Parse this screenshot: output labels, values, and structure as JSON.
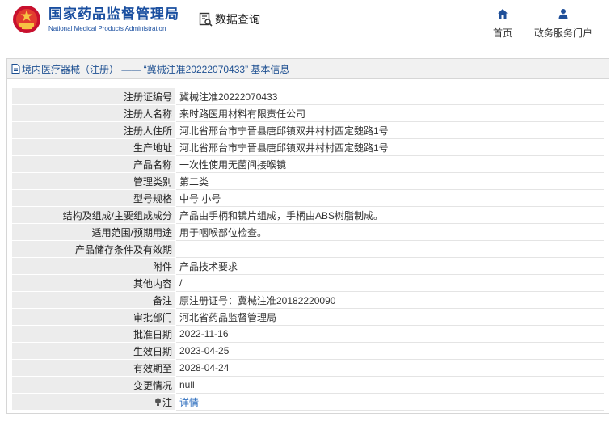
{
  "header": {
    "brand_cn": "国家药品监督管理局",
    "brand_en": "National Medical Products Administration",
    "query_label": "数据查询",
    "nav": [
      {
        "label": "首页",
        "icon": "home-icon"
      },
      {
        "label": "政务服务门户",
        "icon": "user-icon"
      }
    ],
    "brand_color": "#1a4fa0",
    "logo_color": "#c8102e"
  },
  "panel": {
    "title": "境内医疗器械（注册） —— “冀械注准20222070433” 基本信息"
  },
  "rows": [
    {
      "label": "注册证编号",
      "value": "冀械注准20222070433"
    },
    {
      "label": "注册人名称",
      "value": "来时路医用材料有限责任公司"
    },
    {
      "label": "注册人住所",
      "value": "河北省邢台市宁晋县唐邱镇双井村村西定魏路1号"
    },
    {
      "label": "生产地址",
      "value": "河北省邢台市宁晋县唐邱镇双井村村西定魏路1号"
    },
    {
      "label": "产品名称",
      "value": "一次性使用无菌间接喉镜"
    },
    {
      "label": "管理类别",
      "value": "第二类"
    },
    {
      "label": "型号规格",
      "value": "中号 小号"
    },
    {
      "label": "结构及组成/主要组成成分",
      "value": "产品由手柄和镜片组成，手柄由ABS树脂制成。"
    },
    {
      "label": "适用范围/预期用途",
      "value": "用于咽喉部位检查。"
    },
    {
      "label": "产品储存条件及有效期",
      "value": ""
    },
    {
      "label": "附件",
      "value": "产品技术要求"
    },
    {
      "label": "其他内容",
      "value": "/"
    },
    {
      "label": "备注",
      "value": "原注册证号：冀械注准20182220090"
    },
    {
      "label": "审批部门",
      "value": "河北省药品监督管理局"
    },
    {
      "label": "批准日期",
      "value": "2022-11-16"
    },
    {
      "label": "生效日期",
      "value": "2023-04-25"
    },
    {
      "label": "有效期至",
      "value": "2028-04-24"
    },
    {
      "label": "变更情况",
      "value": "null"
    }
  ],
  "note_row": {
    "label": "注",
    "link": "详情",
    "icon": "lightbulb-icon"
  }
}
